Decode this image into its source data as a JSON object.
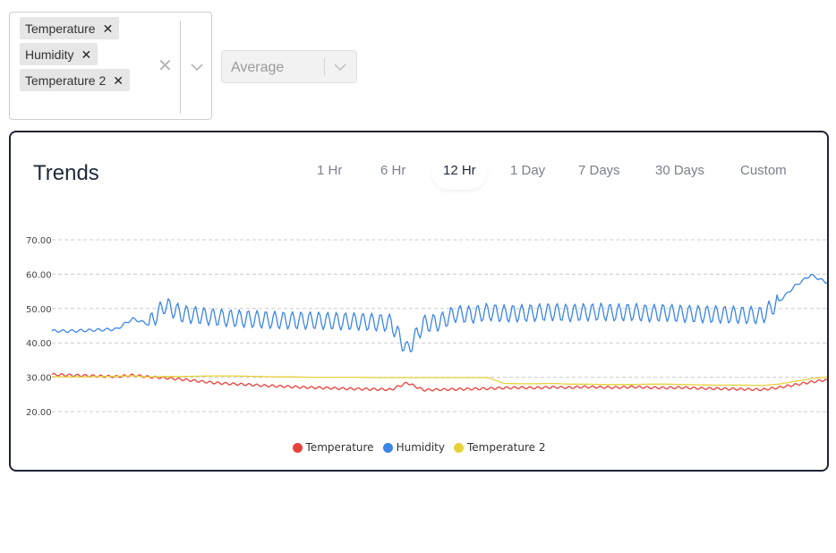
{
  "filters": {
    "selected_sensors": [
      {
        "label": "Temperature"
      },
      {
        "label": "Humidity"
      },
      {
        "label": "Temperature 2"
      }
    ],
    "aggregation": {
      "value": "Average"
    }
  },
  "trends": {
    "title": "Trends",
    "tabs": [
      {
        "label": "1 Hr",
        "active": false
      },
      {
        "label": "6 Hr",
        "active": false
      },
      {
        "label": "12 Hr",
        "active": true
      },
      {
        "label": "1 Day",
        "active": false
      },
      {
        "label": "7 Days",
        "active": false
      },
      {
        "label": "30 Days",
        "active": false
      },
      {
        "label": "Custom",
        "active": false
      }
    ]
  },
  "chart_data": {
    "type": "line",
    "title": "",
    "xlabel": "",
    "ylabel": "",
    "ylim": [
      20,
      70
    ],
    "yticks": [
      "20.00",
      "30.00",
      "40.00",
      "50.00",
      "60.00",
      "70.00"
    ],
    "grid": true,
    "legend_position": "bottom",
    "x": [
      0,
      1,
      2,
      3,
      4,
      5,
      6,
      7,
      8,
      9,
      10,
      11,
      12,
      13,
      14,
      15,
      16,
      17,
      18,
      19,
      20,
      21,
      22,
      23,
      24,
      25,
      26,
      27,
      28,
      29,
      30,
      31,
      32,
      33,
      34,
      35,
      36,
      37,
      38,
      39,
      40,
      41,
      42,
      43,
      44,
      45,
      46,
      47,
      48
    ],
    "series": [
      {
        "name": "Temperature",
        "color": "#e8413b",
        "values": [
          30.8,
          30.6,
          30.5,
          30.3,
          30.2,
          30.6,
          30.1,
          29.8,
          29.4,
          28.9,
          28.4,
          28.1,
          27.9,
          27.6,
          27.4,
          27.2,
          27.0,
          26.9,
          26.7,
          26.6,
          26.5,
          26.4,
          28.4,
          26.3,
          26.4,
          26.5,
          26.6,
          26.7,
          26.9,
          27.0,
          26.9,
          27.1,
          27.0,
          27.2,
          27.1,
          27.0,
          27.2,
          27.0,
          26.9,
          27.0,
          26.8,
          26.7,
          26.6,
          26.5,
          26.4,
          27.0,
          27.8,
          28.6,
          29.3
        ]
      },
      {
        "name": "Humidity",
        "color": "#3b86e8",
        "values": [
          43.5,
          43.4,
          43.6,
          43.8,
          44.0,
          47.0,
          45.5,
          51.0,
          48.5,
          48.0,
          47.5,
          47.2,
          47.0,
          46.8,
          46.6,
          46.5,
          46.5,
          46.4,
          46.3,
          46.2,
          46.0,
          45.8,
          37.8,
          45.5,
          46.0,
          48.5,
          48.2,
          49.0,
          48.5,
          48.6,
          48.8,
          49.0,
          48.7,
          48.9,
          49.0,
          48.8,
          49.0,
          48.6,
          48.8,
          48.5,
          48.4,
          48.3,
          48.2,
          48.1,
          48.0,
          52.0,
          56.5,
          59.8,
          57.5
        ]
      },
      {
        "name": "Temperature 2",
        "color": "#e8d23b",
        "values": [
          30.2,
          30.1,
          30.1,
          30.2,
          30.3,
          30.4,
          30.1,
          30.2,
          30.2,
          30.3,
          30.4,
          30.4,
          30.3,
          30.2,
          30.1,
          30.1,
          30.0,
          30.0,
          30.0,
          30.0,
          29.9,
          29.9,
          29.9,
          29.9,
          29.9,
          29.9,
          29.9,
          29.9,
          28.2,
          28.1,
          28.1,
          28.2,
          28.0,
          28.0,
          27.9,
          27.9,
          27.9,
          28.0,
          28.0,
          27.9,
          27.8,
          27.7,
          27.7,
          27.7,
          27.6,
          28.0,
          28.8,
          29.6,
          30.1
        ]
      }
    ]
  },
  "icons": {
    "remove_chip": "close-icon",
    "clear_all": "close-icon",
    "dropdown": "chevron-down-icon"
  },
  "colors": {
    "card_border": "#1f2433",
    "title": "#1e2a3b",
    "tab_inactive": "#7a808c",
    "grid": "#cccccc"
  }
}
